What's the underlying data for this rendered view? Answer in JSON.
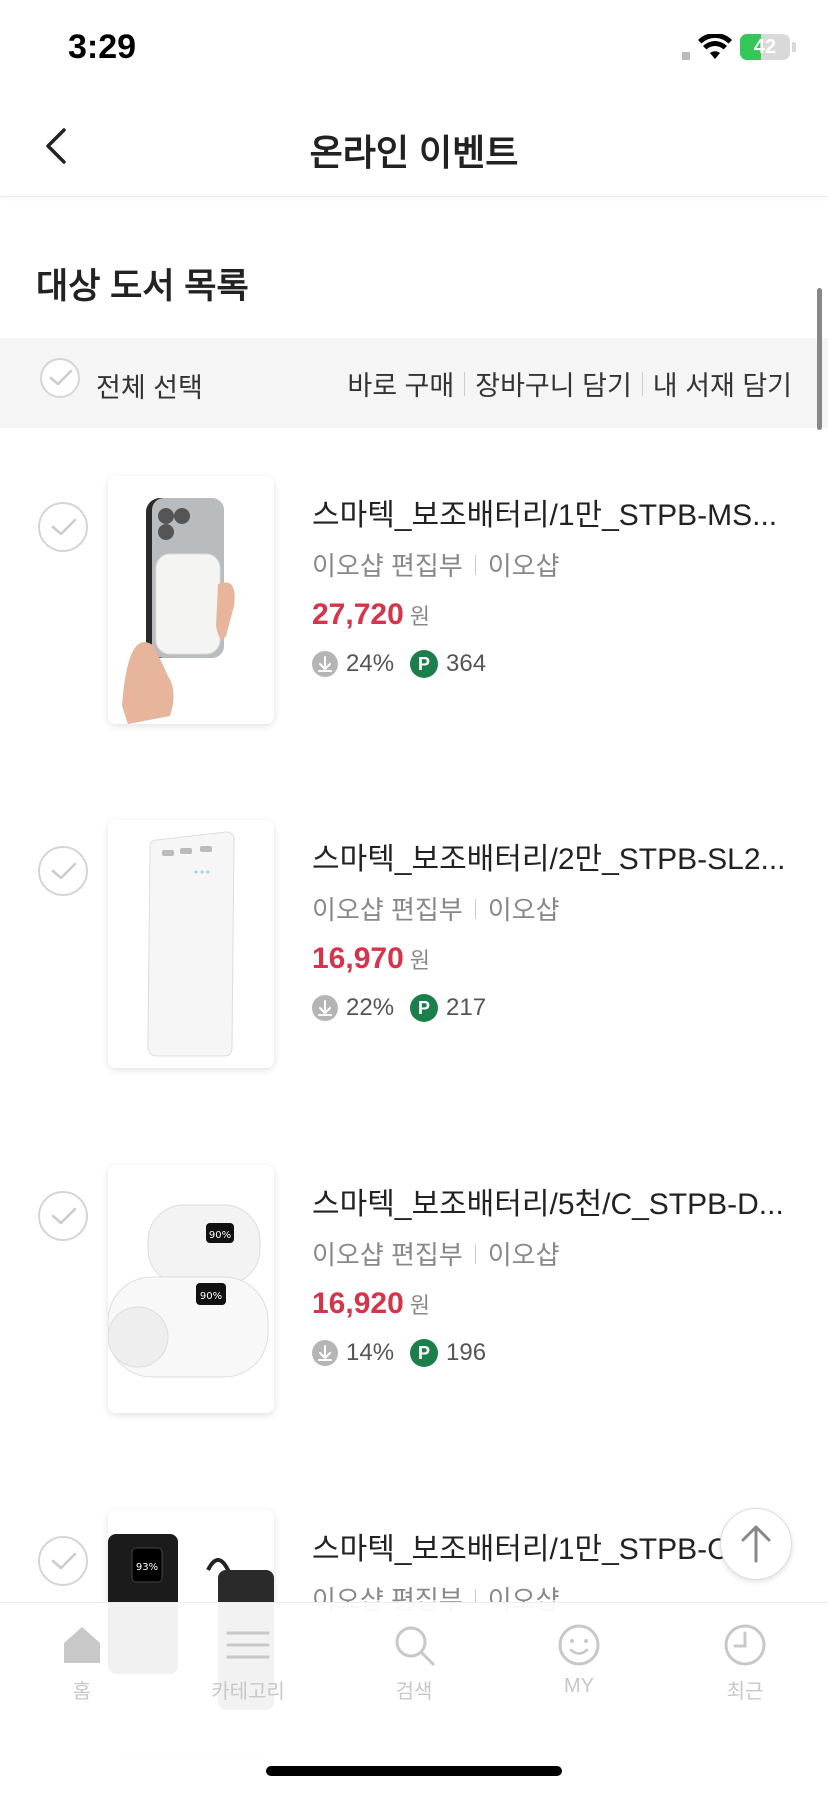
{
  "status": {
    "time": "3:29",
    "battery_level": "42",
    "battery_fraction": 0.42
  },
  "header": {
    "title": "온라인 이벤트",
    "back_icon": "chevron-left-icon"
  },
  "section": {
    "title": "대상 도서 목록"
  },
  "selection": {
    "select_all_label": "전체 선택",
    "buy_now_label": "바로 구매",
    "cart_label": "장바구니 담기",
    "library_label": "내 서재 담기"
  },
  "products": [
    {
      "title": "스마텍_보조배터리/1만_STPB-MS...",
      "author": "이오샵 편집부",
      "publisher": "이오샵",
      "price": "27,720",
      "currency": "원",
      "discount": "24%",
      "points": "364"
    },
    {
      "title": "스마텍_보조배터리/2만_STPB-SL2...",
      "author": "이오샵 편집부",
      "publisher": "이오샵",
      "price": "16,970",
      "currency": "원",
      "discount": "22%",
      "points": "217"
    },
    {
      "title": "스마텍_보조배터리/5천/C_STPB-D...",
      "author": "이오샵 편집부",
      "publisher": "이오샵",
      "price": "16,920",
      "currency": "원",
      "discount": "14%",
      "points": "196"
    },
    {
      "title": "스마텍_보조배터리/1만_STPB-CI",
      "author": "이오샵 편집부",
      "publisher": "이오샵",
      "price": "",
      "currency": "",
      "discount": "",
      "points": ""
    }
  ],
  "product_extra": {
    "thumb1_display": "90%",
    "thumb3_display": "93%"
  },
  "points_badge": "P",
  "tabbar": {
    "tabs": [
      {
        "label": "홈",
        "icon": "home-icon"
      },
      {
        "label": "카테고리",
        "icon": "menu-icon"
      },
      {
        "label": "검색",
        "icon": "search-icon"
      },
      {
        "label": "MY",
        "icon": "smiley-icon"
      },
      {
        "label": "최근",
        "icon": "clock-icon"
      }
    ]
  },
  "colors": {
    "price": "#d6344a",
    "points_badge": "#1a7f4b",
    "battery": "#34c759"
  }
}
